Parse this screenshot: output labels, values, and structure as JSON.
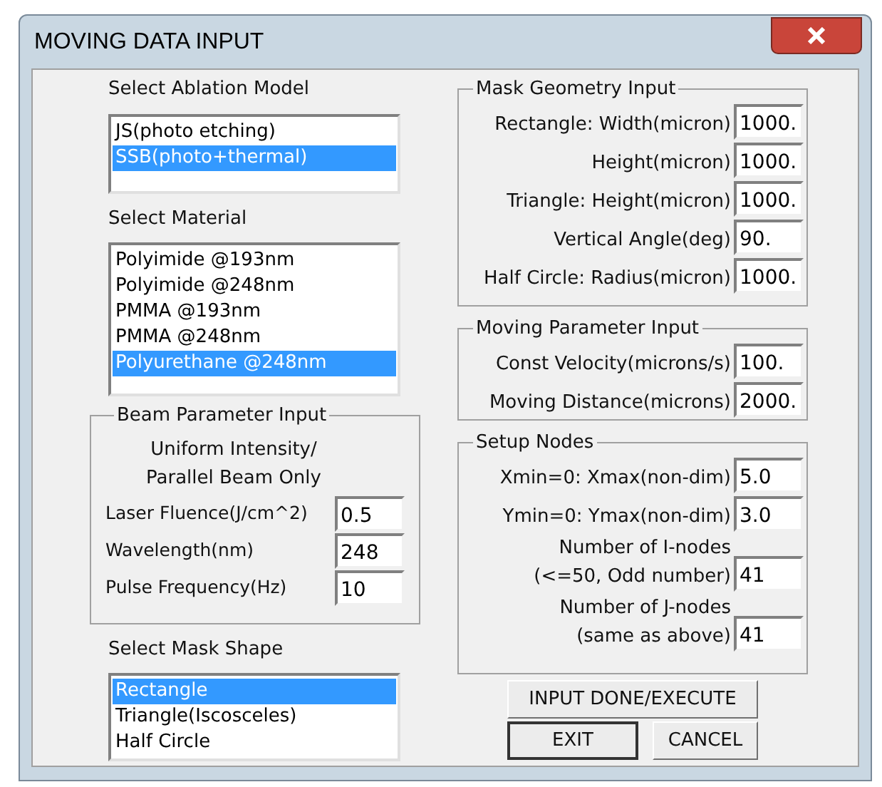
{
  "window": {
    "title": "MOVING DATA INPUT"
  },
  "ablation_model": {
    "label": "Select Ablation Model",
    "items": [
      {
        "text": "JS(photo etching)",
        "selected": false
      },
      {
        "text": "SSB(photo+thermal)",
        "selected": true
      }
    ]
  },
  "material": {
    "label": "Select Material",
    "items": [
      {
        "text": "Polyimide @193nm",
        "selected": false
      },
      {
        "text": "Polyimide @248nm",
        "selected": false
      },
      {
        "text": "PMMA @193nm",
        "selected": false
      },
      {
        "text": "PMMA @248nm",
        "selected": false
      },
      {
        "text": "Polyurethane @248nm",
        "selected": true
      }
    ]
  },
  "beam_parameters": {
    "title": "Beam Parameter Input",
    "note": [
      "Uniform Intensity/",
      "Parallel Beam Only"
    ],
    "fields": [
      {
        "label": "Laser Fluence(J/cm^2)",
        "value": "0.5"
      },
      {
        "label": "Wavelength(nm)",
        "value": "248"
      },
      {
        "label": "Pulse Frequency(Hz)",
        "value": "10"
      }
    ]
  },
  "mask_shape": {
    "label": "Select Mask Shape",
    "items": [
      {
        "text": "Rectangle",
        "selected": true
      },
      {
        "text": "Triangle(Iscosceles)",
        "selected": false
      },
      {
        "text": "Half Circle",
        "selected": false
      }
    ]
  },
  "mask_geometry": {
    "title": "Mask Geometry Input",
    "fields": [
      {
        "label": [
          "Rectangle: Width(micron)"
        ],
        "value": "1000."
      },
      {
        "label": [
          "Height(micron)"
        ],
        "value": "1000."
      },
      {
        "label": [
          "Triangle: Height(micron)"
        ],
        "value": "1000."
      },
      {
        "label": [
          "Vertical Angle(deg)"
        ],
        "value": "90."
      },
      {
        "label": [
          "Half Circle: Radius(micron)"
        ],
        "value": "1000."
      }
    ]
  },
  "moving_parameters": {
    "title": "Moving Parameter Input",
    "fields": [
      {
        "label": [
          "Const Velocity(microns/s)"
        ],
        "value": "100."
      },
      {
        "label": [
          "Moving Distance(microns)"
        ],
        "value": "2000."
      }
    ]
  },
  "setup_nodes": {
    "title": "Setup Nodes",
    "fields": [
      {
        "label": [
          "Xmin=0: Xmax(non-dim)"
        ],
        "value": "5.0"
      },
      {
        "label": [
          "Ymin=0: Ymax(non-dim)"
        ],
        "value": "3.0"
      },
      {
        "label": [
          "Number of I-nodes",
          "(<=50, Odd number)"
        ],
        "value": "41"
      },
      {
        "label": [
          "Number of J-nodes",
          "(same as above)"
        ],
        "value": "41"
      }
    ]
  },
  "buttons": [
    {
      "label": "INPUT DONE/EXECUTE",
      "default": false
    },
    {
      "label": "EXIT",
      "default": true
    },
    {
      "label": "CANCEL",
      "default": false
    }
  ]
}
